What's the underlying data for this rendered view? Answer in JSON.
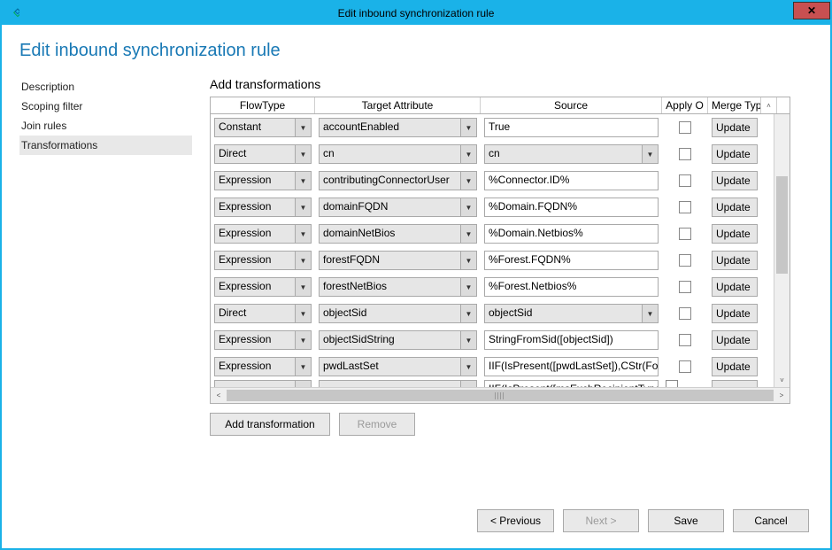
{
  "window": {
    "title": "Edit inbound synchronization rule"
  },
  "heading": "Edit inbound synchronization rule",
  "sidebar": {
    "items": [
      {
        "label": "Description"
      },
      {
        "label": "Scoping filter"
      },
      {
        "label": "Join rules"
      },
      {
        "label": "Transformations"
      }
    ]
  },
  "section": {
    "title": "Add transformations"
  },
  "grid": {
    "headers": {
      "flow": "FlowType",
      "target": "Target Attribute",
      "source": "Source",
      "apply": "Apply O",
      "merge": "Merge Type"
    },
    "rows": [
      {
        "flow": "Constant",
        "target": "accountEnabled",
        "source": "True",
        "sourceCombo": false,
        "merge": "Update"
      },
      {
        "flow": "Direct",
        "target": "cn",
        "source": "cn",
        "sourceCombo": true,
        "merge": "Update"
      },
      {
        "flow": "Expression",
        "target": "contributingConnectorUser",
        "source": "%Connector.ID%",
        "sourceCombo": false,
        "merge": "Update"
      },
      {
        "flow": "Expression",
        "target": "domainFQDN",
        "source": "%Domain.FQDN%",
        "sourceCombo": false,
        "merge": "Update"
      },
      {
        "flow": "Expression",
        "target": "domainNetBios",
        "source": "%Domain.Netbios%",
        "sourceCombo": false,
        "merge": "Update"
      },
      {
        "flow": "Expression",
        "target": "forestFQDN",
        "source": "%Forest.FQDN%",
        "sourceCombo": false,
        "merge": "Update"
      },
      {
        "flow": "Expression",
        "target": "forestNetBios",
        "source": "%Forest.Netbios%",
        "sourceCombo": false,
        "merge": "Update"
      },
      {
        "flow": "Direct",
        "target": "objectSid",
        "source": "objectSid",
        "sourceCombo": true,
        "merge": "Update"
      },
      {
        "flow": "Expression",
        "target": "objectSidString",
        "source": "StringFromSid([objectSid])",
        "sourceCombo": false,
        "merge": "Update"
      },
      {
        "flow": "Expression",
        "target": "pwdLastSet",
        "source": "IIF(IsPresent([pwdLastSet]),CStr(For",
        "sourceCombo": false,
        "merge": "Update"
      }
    ],
    "partialNextSource": "IIF(IsPresent([msExchRecipientType"
  },
  "buttons": {
    "addTransformation": "Add transformation",
    "remove": "Remove",
    "previous": "< Previous",
    "next": "Next >",
    "save": "Save",
    "cancel": "Cancel"
  }
}
